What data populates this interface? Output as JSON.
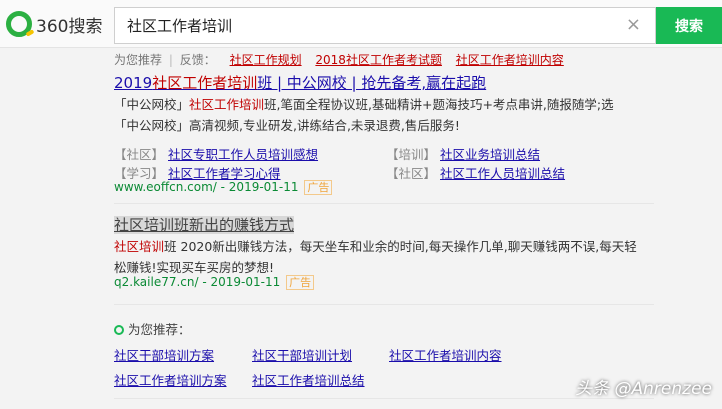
{
  "header": {
    "logo_text": "360搜索",
    "search_value": "社区工作者培训",
    "clear_icon": "×",
    "search_button": "搜索"
  },
  "recommend_bar": {
    "label": "为您推荐",
    "separator": "|",
    "feedback": "反馈：",
    "items": [
      "社区工作规划",
      "2018社区工作者考试题",
      "社区工作者培训内容"
    ]
  },
  "result1": {
    "title_pre": "2019",
    "title_em": "社区工作者培训",
    "title_post": "班 | 中公网校 | 抢先备考,赢在起跑",
    "desc1_a": "「中公网校」",
    "desc1_em": "社区工作培训",
    "desc1_b": "班,笔面全程协议班,基础精讲+题海技巧+考点串讲,随报随学;选",
    "desc2": "「中公网校」高清视频,专业研发,讲练结合,未录退费,售后服务!",
    "sublinks": [
      {
        "tag": "【社区】",
        "text": "社区专职工作人员培训感想"
      },
      {
        "tag": "【培训】",
        "text": "社区业务培训总结"
      },
      {
        "tag": "【学习】",
        "text": "社区工作者学习心得"
      },
      {
        "tag": "【社区】",
        "text": "社区工作人员培训总结"
      }
    ],
    "url": "www.eoffcn.com/ - 2019-01-11",
    "ad": "广告"
  },
  "result2": {
    "title": "社区培训班新出的赚钱方式",
    "desc1_em": "社区培训",
    "desc1_b": "班 2020新出赚钱方法，每天坐车和业余的时间,每天操作几单,聊天赚钱两不误,每天轻",
    "desc2": "松赚钱!实现买车买房的梦想!",
    "url": "q2.kaile77.cn/ - 2019-01-11",
    "ad": "广告"
  },
  "recommend_section": {
    "title": "为您推荐：",
    "links": [
      "社区干部培训方案",
      "社区干部培训计划",
      "社区工作者培训内容",
      "社区工作者培训方案",
      "社区工作者培训总结"
    ]
  },
  "watermark": "头条 @Anrenzee",
  "colors": {
    "brand_green": "#19b955",
    "link_blue": "#1a0dab",
    "highlight_red": "#c00000",
    "url_green": "#0b8a35"
  }
}
